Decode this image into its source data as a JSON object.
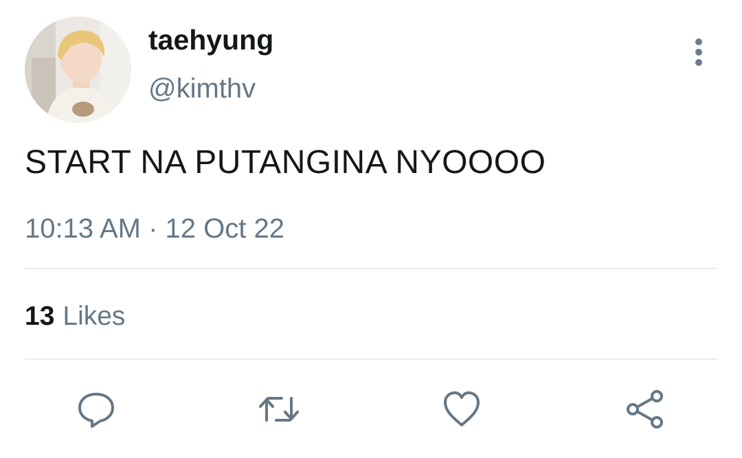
{
  "tweet": {
    "display_name": "taehyung",
    "handle": "@kimthv",
    "text": "START NA PUTANGINA NYOOOO",
    "timestamp": "10:13 AM · 12 Oct 22",
    "likes_count": "13",
    "likes_label": "Likes"
  },
  "icons": {
    "more": "more-vertical-icon",
    "reply": "reply-icon",
    "retweet": "retweet-icon",
    "like": "heart-icon",
    "share": "share-icon"
  },
  "colors": {
    "text_primary": "#14171a",
    "text_secondary": "#657786",
    "icon": "#657786",
    "divider": "#e6ecf0"
  }
}
